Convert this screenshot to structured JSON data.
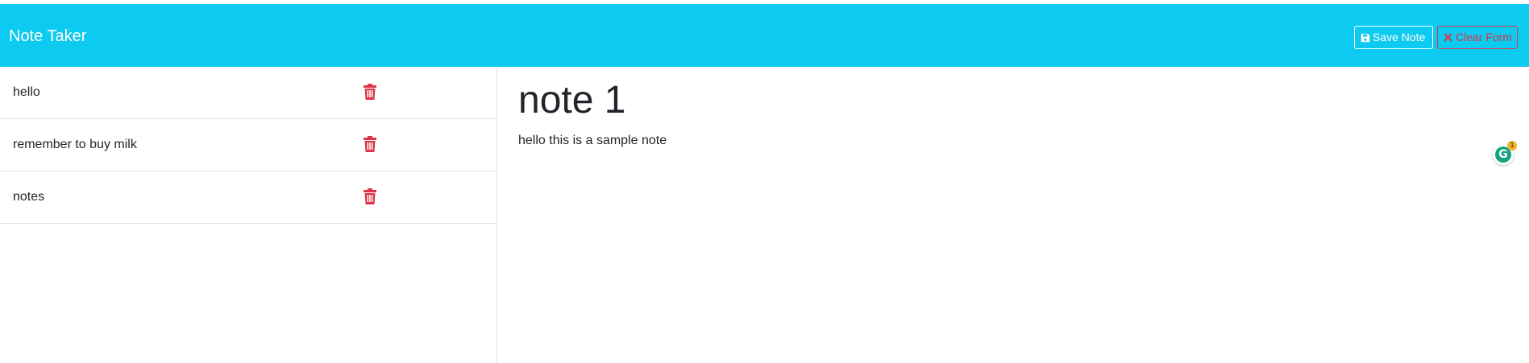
{
  "navbar": {
    "brand": "Note Taker",
    "save_label": "Save Note",
    "clear_label": "Clear Form",
    "background": "#0dcaf0",
    "clear_color": "#dc3545"
  },
  "sidebar": {
    "items": [
      {
        "label": "hello",
        "icon": "trash-icon"
      },
      {
        "label": "remember to buy milk",
        "icon": "trash-icon"
      },
      {
        "label": "notes",
        "icon": "trash-icon"
      }
    ]
  },
  "main": {
    "note_title": "note 1",
    "note_text": "hello this is a sample note"
  },
  "extension": {
    "icon": "grammarly-icon",
    "letter": "G",
    "badge_count": "1"
  }
}
